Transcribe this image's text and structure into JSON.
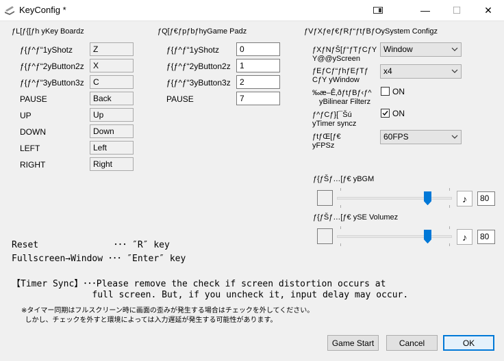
{
  "window": {
    "title": "KeyConfig *",
    "controls": {
      "minimize": "—",
      "maximize": "☐",
      "close": "✕"
    }
  },
  "keyboard": {
    "heading": "ƒL[ƒ{[ƒh yKey Boardz",
    "rows": [
      {
        "label": "ƒ{ƒ^ƒ“1yShotz",
        "value": "Z"
      },
      {
        "label": "ƒ{ƒ^ƒ“2yButton2z",
        "value": "X"
      },
      {
        "label": "ƒ{ƒ^ƒ“3yButton3z",
        "value": "C"
      },
      {
        "label": "PAUSE",
        "value": "Back"
      },
      {
        "label": "UP",
        "value": "Up"
      },
      {
        "label": "DOWN",
        "value": "Down"
      },
      {
        "label": "LEFT",
        "value": "Left"
      },
      {
        "label": "RIGHT",
        "value": "Right"
      }
    ]
  },
  "gamepad": {
    "heading": "ƒQ[ƒ€ƒpƒbƒhyGame Padz",
    "rows": [
      {
        "label": "ƒ{ƒ^ƒ“1yShotz",
        "value": "0"
      },
      {
        "label": "ƒ{ƒ^ƒ“2yButton2z",
        "value": "1"
      },
      {
        "label": "ƒ{ƒ^ƒ“3yButton3z",
        "value": "2"
      },
      {
        "label": "PAUSE",
        "value": "7"
      }
    ]
  },
  "system": {
    "heading": "ƒVƒXƒeƒ€ƒRƒ“ƒtƒBƒOySystem Configz",
    "screen_label_1": "ƒXƒNƒŠ[ƒ“ƒTƒCƒY",
    "screen_label_2": "Y@@yScreen",
    "screen_value": "Window",
    "window_label_1": "ƒEƒCƒ“ƒhƒEƒTƒ",
    "window_label_2": "CƒY  yWindow",
    "window_value": "x4",
    "bilinear_label_1": "‰æ–Ê‚ðƒtƒBƒ‹ƒ^",
    "bilinear_label_2": "yBilinear Filterz",
    "bilinear_state": "ON",
    "timer_label_1": "ƒ^ƒCƒ}[¯Šú",
    "timer_label_2": "yTimer syncz",
    "timer_state": "ON",
    "fps_label_1": "ƒtƒŒ[ƒ€",
    "fps_label_2": "yFPSz",
    "fps_value": "60FPS"
  },
  "audio": {
    "bgm_label": "ƒ{ƒŠƒ…[ƒ€ yBGM",
    "bgm_value": "80",
    "bgm_level": 0.8,
    "se_label": "ƒ{ƒŠƒ…[ƒ€ ySE Volumez",
    "se_value": "80",
    "se_level": 0.8,
    "note_icon": "♪"
  },
  "help": {
    "reset_line": "Reset              ･･･ ″R″ key",
    "fullscreen_line": "Fullscreen→Window ･･･ ″Enter″ key",
    "timer_line_1": "【Timer Sync】･･･Please remove the check if screen distortion occurs at",
    "timer_line_2": "               full screen. But, if you uncheck it, input delay may occur.",
    "jp_line_1": "※タイマー同期はフルスクリーン時に画面の歪みが発生する場合はチェックを外してください。",
    "jp_line_2": "  しかし、チェックを外すと環境によっては入力遅延が発生する可能性があります。"
  },
  "buttons": {
    "game_start": "Game Start",
    "cancel": "Cancel",
    "ok": "OK"
  },
  "colors": {
    "accent": "#0078d7"
  }
}
